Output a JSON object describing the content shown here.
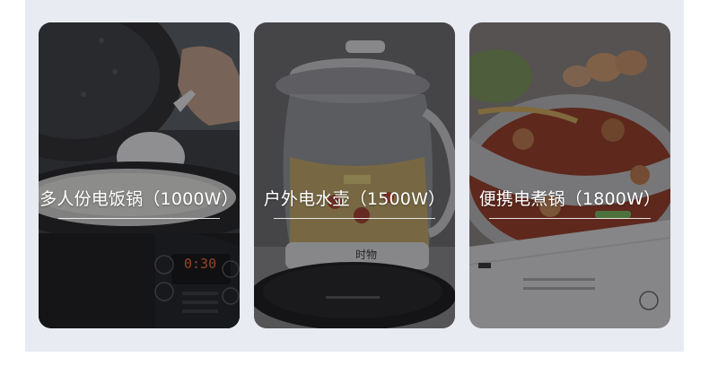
{
  "cards": [
    {
      "label": "多人份电饭锅（1000W）",
      "display": "0:30"
    },
    {
      "label": "户外电水壶（1500W）",
      "brand_mark": "时物"
    },
    {
      "label": "便携电煮锅（1800W）"
    }
  ]
}
